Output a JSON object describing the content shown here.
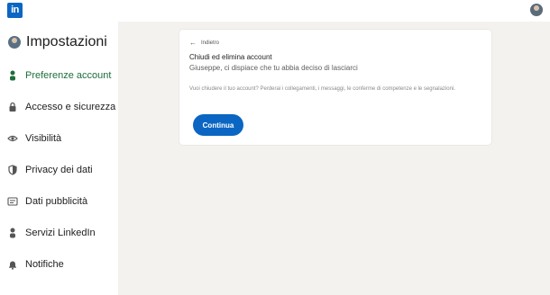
{
  "header": {
    "logo_text": "in",
    "logo_icon": "linkedin-logo-icon",
    "avatar_icon": "user-avatar-icon"
  },
  "sidebar": {
    "title": "Impostazioni",
    "items": [
      {
        "label": "Preferenze account",
        "icon": "person-icon",
        "active": true
      },
      {
        "label": "Accesso e sicurezza",
        "icon": "lock-icon",
        "active": false
      },
      {
        "label": "Visibilità",
        "icon": "eye-icon",
        "active": false
      },
      {
        "label": "Privacy dei dati",
        "icon": "shield-icon",
        "active": false
      },
      {
        "label": "Dati pubblicità",
        "icon": "ad-icon",
        "active": false
      },
      {
        "label": "Servizi LinkedIn",
        "icon": "person-icon",
        "active": false
      },
      {
        "label": "Notifiche",
        "icon": "bell-icon",
        "active": false
      }
    ]
  },
  "card": {
    "back_label": "Indietro",
    "title": "Chiudi ed elimina account",
    "subtitle": "Giuseppe, ci dispiace che tu abbia deciso di lasciarci",
    "description": "Vuoi chiudere il tuo account? Perderai i collegamenti, i messaggi, le conferme di competenze e le segnalazioni.",
    "continue_label": "Continua"
  },
  "colors": {
    "brand": "#0a66c2",
    "active_nav": "#1d6d3a",
    "background": "#f4f2ee"
  }
}
